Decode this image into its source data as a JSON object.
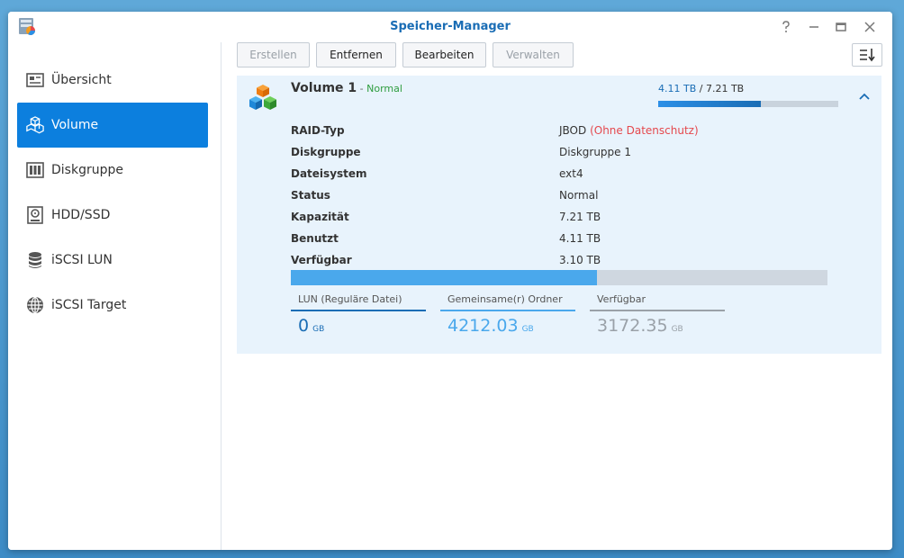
{
  "window": {
    "title": "Speicher-Manager",
    "controls": [
      "help",
      "minimize",
      "maximize",
      "close"
    ]
  },
  "sidebar": {
    "items": [
      {
        "label": "Übersicht",
        "icon": "overview-icon",
        "active": false
      },
      {
        "label": "Volume",
        "icon": "volume-cubes-icon",
        "active": true
      },
      {
        "label": "Diskgruppe",
        "icon": "disk-group-icon",
        "active": false
      },
      {
        "label": "HDD/SSD",
        "icon": "hdd-icon",
        "active": false
      },
      {
        "label": "iSCSI LUN",
        "icon": "database-icon",
        "active": false
      },
      {
        "label": "iSCSI Target",
        "icon": "globe-icon",
        "active": false
      }
    ]
  },
  "toolbar": {
    "create_label": "Erstellen",
    "remove_label": "Entfernen",
    "edit_label": "Bearbeiten",
    "manage_label": "Verwalten"
  },
  "volume": {
    "name": "Volume 1",
    "separator": " - ",
    "status_inline": "Normal",
    "capacity_used": "4.11 TB",
    "capacity_sep": " / ",
    "capacity_total": "7.21 TB",
    "usage_fraction": 0.57,
    "details": {
      "raid_label": "RAID-Typ",
      "raid_value": "JBOD",
      "raid_note": "(Ohne Datenschutz)",
      "diskgroup_label": "Diskgruppe",
      "diskgroup_value": "Diskgruppe 1",
      "filesystem_label": "Dateisystem",
      "filesystem_value": "ext4",
      "status_label": "Status",
      "status_value": "Normal",
      "capacity_label": "Kapazität",
      "capacity_value": "7.21 TB",
      "used_label": "Benutzt",
      "used_value": "4.11 TB",
      "available_label": "Verfügbar",
      "available_value": "3.10 TB"
    },
    "stats": [
      {
        "label": "LUN (Reguläre Datei)",
        "value": "0",
        "unit": "GB",
        "color": "#1a6db5"
      },
      {
        "label": "Gemeinsame(r) Ordner",
        "value": "4212.03",
        "unit": "GB",
        "color": "#4aa8ec"
      },
      {
        "label": "Verfügbar",
        "value": "3172.35",
        "unit": "GB",
        "color": "#9aa1a8"
      }
    ]
  },
  "colors": {
    "accent": "#0c7fde",
    "title": "#1a6db5",
    "normal": "#2e9d3f",
    "warning": "#e5484d"
  }
}
